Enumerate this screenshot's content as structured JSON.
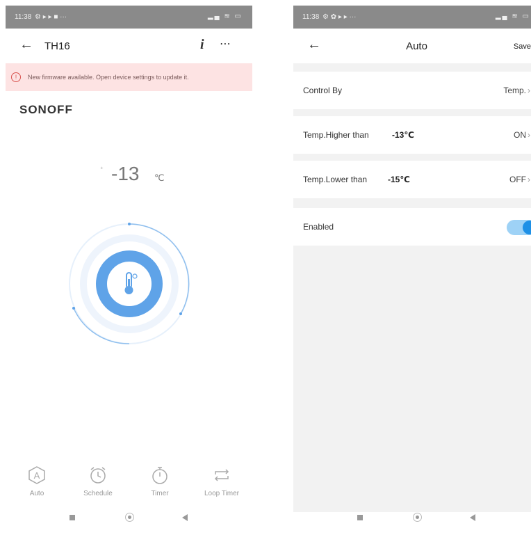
{
  "left": {
    "status_time": "11:38",
    "status_icons": "⚙ ▸ ▸ ■ ···",
    "status_sys": "▂▄ ≋ ▭",
    "device_title": "TH16",
    "banner_text": "New firmware available. Open device settings to update it.",
    "brand": "SONOFF",
    "temperature_value": "-13",
    "temperature_unit": "℃",
    "tabs": [
      {
        "label": "Auto",
        "icon": "auto-icon"
      },
      {
        "label": "Schedule",
        "icon": "alarm-clock-icon"
      },
      {
        "label": "Timer",
        "icon": "stopwatch-icon"
      },
      {
        "label": "Loop Timer",
        "icon": "loop-icon"
      }
    ]
  },
  "right": {
    "status_time": "11:38",
    "status_icons": "⚙ ✿ ▸ ▸ ···",
    "status_sys": "▂▄ ≋ ▭",
    "title": "Auto",
    "save_label": "Save",
    "rows": [
      {
        "label": "Control By",
        "value": "",
        "right": "Temp."
      },
      {
        "label": "Temp.Higher than",
        "value": "-13℃",
        "right": "ON"
      },
      {
        "label": "Temp.Lower than",
        "value": "-15℃",
        "right": "OFF"
      },
      {
        "label": "Enabled",
        "value": "",
        "right": ""
      }
    ],
    "enabled": true
  },
  "colors": {
    "accent": "#1e90e6",
    "dial_ring": "#5fa3e8",
    "banner_bg": "#fde3e3",
    "statusbar": "#8a8a8a"
  }
}
